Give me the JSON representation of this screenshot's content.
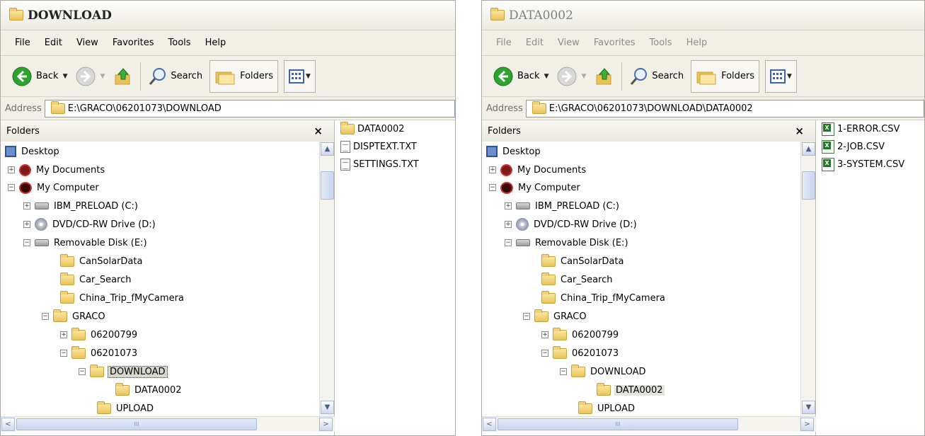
{
  "windows": [
    {
      "title": "DOWNLOAD",
      "menu": [
        "File",
        "Edit",
        "View",
        "Favorites",
        "Tools",
        "Help"
      ],
      "toolbar": {
        "back": "Back",
        "search": "Search",
        "folders": "Folders"
      },
      "address": {
        "label": "Address",
        "path": "E:\\GRACO\\06201073\\DOWNLOAD"
      },
      "folders_pane": {
        "title": "Folders",
        "close": "×"
      },
      "tree": {
        "desktop": "Desktop",
        "my_documents": "My Documents",
        "my_computer": "My Computer",
        "drive_c": "IBM_PRELOAD (C:)",
        "drive_d": "DVD/CD-RW Drive (D:)",
        "drive_e": "Removable Disk (E:)",
        "cansolar": "CanSolarData",
        "car_search": "Car_Search",
        "china_trip": "China_Trip_fMyCamera",
        "graco": "GRACO",
        "f06200799": "06200799",
        "f06201073": "06201073",
        "download": "DOWNLOAD",
        "data0002": "DATA0002",
        "upload": "UPLOAD"
      },
      "files": [
        "DATA0002",
        "DISPTEXT.TXT",
        "SETTINGS.TXT"
      ]
    },
    {
      "title": "DATA0002",
      "menu": [
        "File",
        "Edit",
        "View",
        "Favorites",
        "Tools",
        "Help"
      ],
      "toolbar": {
        "back": "Back",
        "search": "Search",
        "folders": "Folders"
      },
      "address": {
        "label": "Address",
        "path": "E:\\GRACO\\06201073\\DOWNLOAD\\DATA0002"
      },
      "folders_pane": {
        "title": "Folders",
        "close": "×"
      },
      "tree": {
        "desktop": "Desktop",
        "my_documents": "My Documents",
        "my_computer": "My Computer",
        "drive_c": "IBM_PRELOAD (C:)",
        "drive_d": "DVD/CD-RW Drive (D:)",
        "drive_e": "Removable Disk (E:)",
        "cansolar": "CanSolarData",
        "car_search": "Car_Search",
        "china_trip": "China_Trip_fMyCamera",
        "graco": "GRACO",
        "f06200799": "06200799",
        "f06201073": "06201073",
        "download": "DOWNLOAD",
        "data0002": "DATA0002",
        "upload": "UPLOAD"
      },
      "files": [
        "1-ERROR.CSV",
        "2-JOB.CSV",
        "3-SYSTEM.CSV"
      ]
    }
  ],
  "scroll_glyphs": {
    "up": "▲",
    "down": "▼",
    "left": "<",
    "right": ">",
    "grip": "III"
  }
}
